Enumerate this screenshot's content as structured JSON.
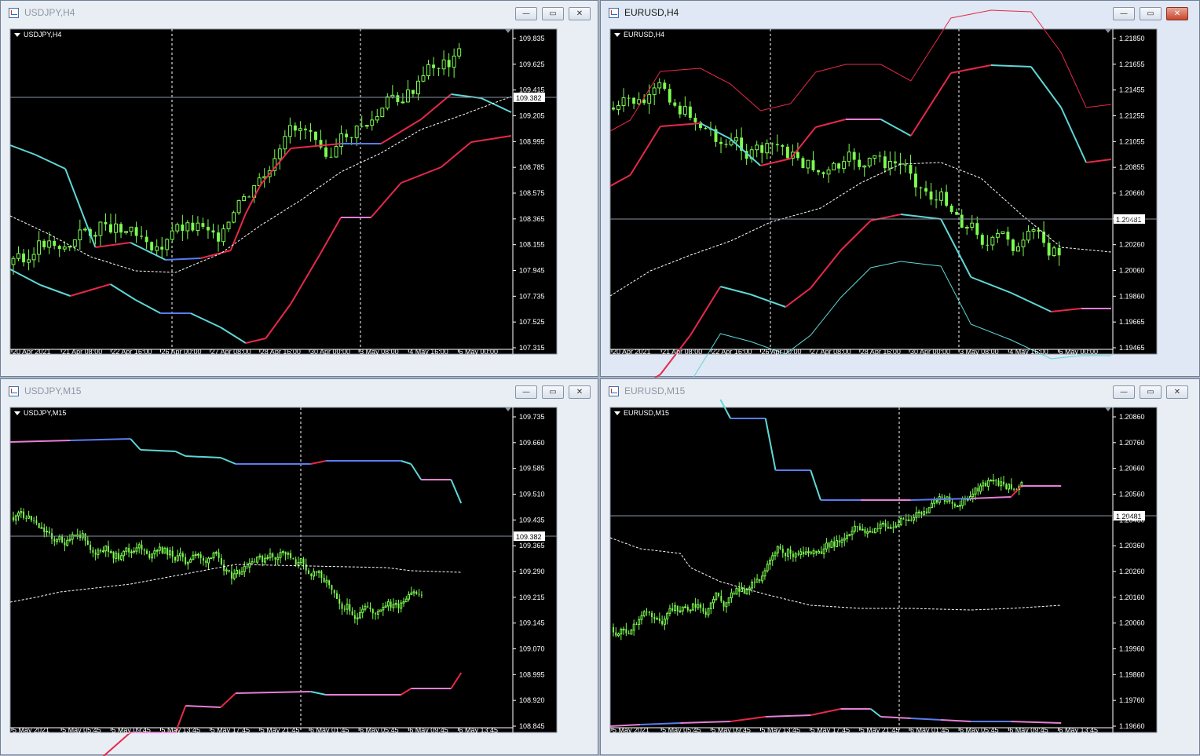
{
  "charts": [
    {
      "title": "USDJPY,H4",
      "label": "USDJPY,H4",
      "active": false,
      "price_label": "109.382",
      "price_label_color": "#ffffff",
      "y_ticks": [
        "109.835",
        "109.625",
        "109.415",
        "109.205",
        "108.995",
        "108.785",
        "108.575",
        "108.365",
        "108.155",
        "107.945",
        "107.735",
        "107.525",
        "107.315"
      ],
      "x_ticks": [
        "20 Apr 2021",
        "21 Apr 08:00",
        "22 Apr 16:00",
        "26 Apr 00:00",
        "27 Apr 08:00",
        "28 Apr 16:00",
        "30 Apr 00:00",
        "3 May 08:00",
        "4 May 16:00",
        "6 May 00:00"
      ]
    },
    {
      "title": "EURUSD,H4",
      "label": "EURUSD,H4",
      "active": true,
      "price_label": "1.20481",
      "price_label_color": "#ffffff",
      "y_ticks": [
        "1.21850",
        "1.21655",
        "1.21455",
        "1.21255",
        "1.21055",
        "1.20855",
        "1.20660",
        "1.20460",
        "1.20260",
        "1.20060",
        "1.19860",
        "1.19665",
        "1.19465"
      ],
      "x_ticks": [
        "20 Apr 2021",
        "21 Apr 08:00",
        "22 Apr 16:00",
        "26 Apr 00:00",
        "27 Apr 08:00",
        "28 Apr 16:00",
        "30 Apr 00:00",
        "3 May 08:00",
        "4 May 16:00",
        "6 May 00:00"
      ]
    },
    {
      "title": "USDJPY,M15",
      "label": "USDJPY,M15",
      "active": false,
      "price_label": "109.382",
      "price_label_color": "#ffffff",
      "y_ticks": [
        "109.735",
        "109.660",
        "109.585",
        "109.510",
        "109.435",
        "109.365",
        "109.290",
        "109.215",
        "109.145",
        "109.070",
        "108.995",
        "108.920",
        "108.845"
      ],
      "x_ticks": [
        "5 May 2021",
        "5 May 05:45",
        "5 May 09:45",
        "5 May 13:45",
        "5 May 17:45",
        "5 May 21:45",
        "6 May 01:45",
        "6 May 05:45",
        "6 May 09:45",
        "6 May 13:45"
      ]
    },
    {
      "title": "EURUSD,M15",
      "label": "EURUSD,M15",
      "active": false,
      "price_label": "1.20481",
      "price_label_color": "#ffffff",
      "y_ticks": [
        "1.20860",
        "1.20760",
        "1.20660",
        "1.20560",
        "1.20460",
        "1.20360",
        "1.20260",
        "1.20160",
        "1.20060",
        "1.19960",
        "1.19860",
        "1.19760",
        "1.19660"
      ],
      "x_ticks": [
        "5 May 2021",
        "5 May 05:45",
        "5 May 09:45",
        "5 May 13:45",
        "5 May 17:45",
        "5 May 21:45",
        "6 May 01:45",
        "6 May 05:45",
        "6 May 09:45",
        "6 May 13:45"
      ]
    }
  ],
  "window_buttons": {
    "minimize": "—",
    "maximize": "▭",
    "close": "✕"
  },
  "colors": {
    "up_candle": "#7cfc50",
    "band_rising": "#5fd7d7",
    "band_falling": "#e8284a",
    "band_flat_up": "#5b7cf0",
    "band_flat_down": "#e77fd6",
    "midline": "#ffffff"
  }
}
